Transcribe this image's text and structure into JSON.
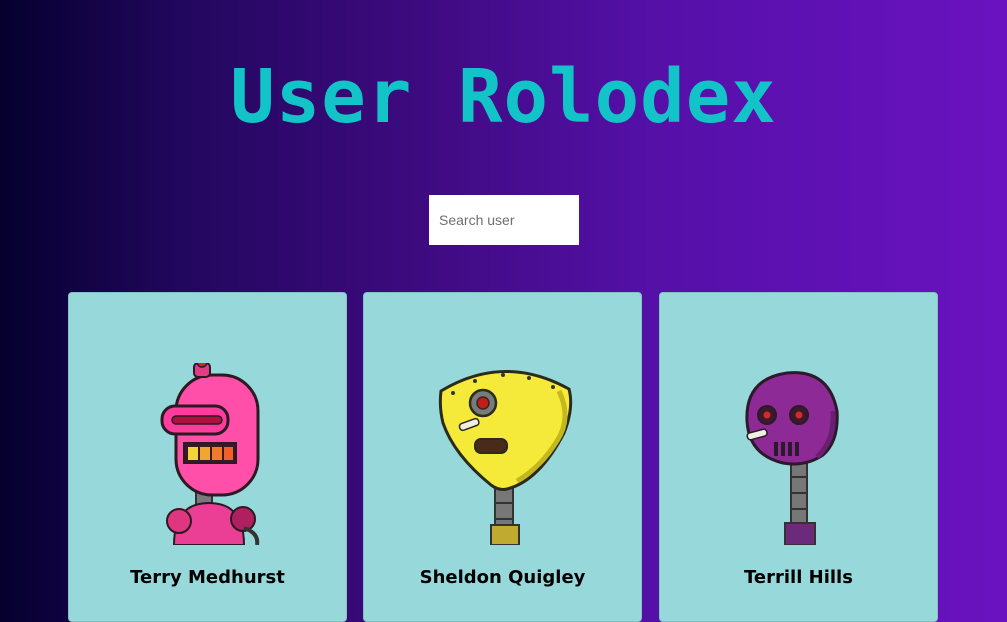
{
  "app": {
    "title": "User Rolodex"
  },
  "search": {
    "placeholder": "Search user",
    "value": ""
  },
  "cards": [
    {
      "name": "Terry Medhurst",
      "avatar_icon": "pink-robot-icon"
    },
    {
      "name": "Sheldon Quigley",
      "avatar_icon": "yellow-robot-icon"
    },
    {
      "name": "Terrill Hills",
      "avatar_icon": "purple-robot-icon"
    }
  ],
  "colors": {
    "title": "#12c4c7",
    "card_background": "#97d9db",
    "gradient_start": "#05002e",
    "gradient_end": "#6a12c0"
  }
}
